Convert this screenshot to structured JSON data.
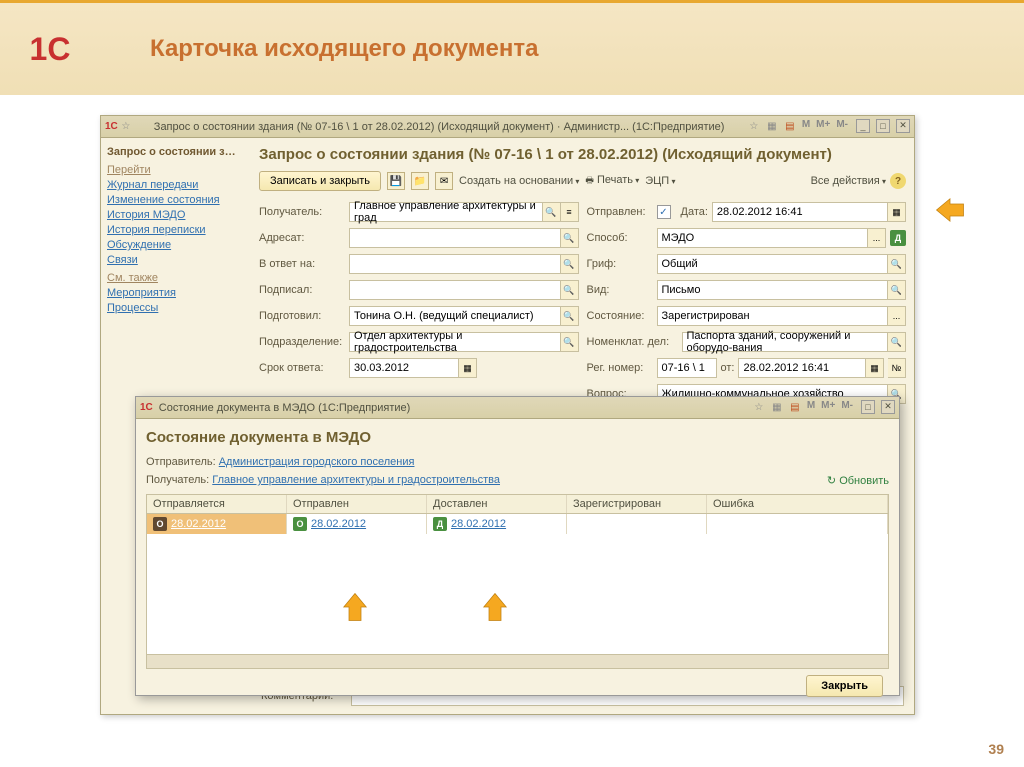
{
  "slide": {
    "title": "Карточка исходящего документа",
    "page_num": "39"
  },
  "logo": "1С",
  "window": {
    "titlebar": "Запрос о состоянии здания (№ 07-16 \\ 1 от 28.02.2012) (Исходящий документ) · Администр... (1С:Предприятие)",
    "doc_title": "Запрос о состоянии здания (№ 07-16 \\ 1 от 28.02.2012) (Исходящий документ)"
  },
  "sidebar": {
    "title": "Запрос о состоянии з…",
    "section1": "Перейти",
    "items1": [
      "Журнал передачи",
      "Изменение состояния",
      "История МЭДО",
      "История переписки",
      "Обсуждение",
      "Связи"
    ],
    "section2": "См. также",
    "items2": [
      "Мероприятия",
      "Процессы"
    ]
  },
  "toolbar": {
    "save_close": "Записать и закрыть",
    "create_based": "Создать на основании",
    "print": "Печать",
    "ecp": "ЭЦП",
    "all_actions": "Все действия"
  },
  "form": {
    "left": {
      "recipient_label": "Получатель:",
      "recipient": "Главное управление архитектуры и град",
      "addressee_label": "Адресат:",
      "addressee": "",
      "reply_to_label": "В ответ на:",
      "reply_to": "",
      "signed_by_label": "Подписал:",
      "signed_by": "",
      "prepared_label": "Подготовил:",
      "prepared": "Тонина О.Н. (ведущий специалист)",
      "department_label": "Подразделение:",
      "department": "Отдел архитектуры и градостроительства",
      "deadline_label": "Срок ответа:",
      "deadline": "30.03.2012"
    },
    "right": {
      "sent_label": "Отправлен:",
      "sent_check": "✓",
      "date_label": "Дата:",
      "date": "28.02.2012 16:41",
      "method_label": "Способ:",
      "method": "МЭДО",
      "grif_label": "Гриф:",
      "grif": "Общий",
      "type_label": "Вид:",
      "type": "Письмо",
      "state_label": "Состояние:",
      "state": "Зарегистрирован",
      "nomenclature_label": "Номенклат. дел:",
      "nomenclature": "Паспорта зданий, сооружений и оборудо-вания",
      "regnum_label": "Рег. номер:",
      "regnum": "07-16 \\ 1",
      "regfrom_label": "от:",
      "regfrom": "28.02.2012 16:41",
      "question_label": "Вопрос:",
      "question": "Жилищно-коммунальное хозяйство"
    },
    "reg_btn": "№",
    "comment_label": "Комментарий:"
  },
  "modal": {
    "titlebar": "Состояние документа в МЭДО  (1С:Предприятие)",
    "title": "Состояние документа в МЭДО",
    "sender_label": "Отправитель:",
    "sender": "Администрация городского поселения",
    "recipient_label": "Получатель:",
    "recipient": "Главное управление архитектуры и градостроительства",
    "refresh": "Обновить",
    "cols": [
      "Отправляется",
      "Отправлен",
      "Доставлен",
      "Зарегистрирован",
      "Ошибка"
    ],
    "row": {
      "c1_icon": "О",
      "c1": "28.02.2012",
      "c2_icon": "О",
      "c2": "28.02.2012",
      "c3_icon": "Д",
      "c3": "28.02.2012"
    },
    "close": "Закрыть"
  },
  "m_buttons": {
    "m": "M",
    "mplus": "M+",
    "mminus": "M-"
  }
}
